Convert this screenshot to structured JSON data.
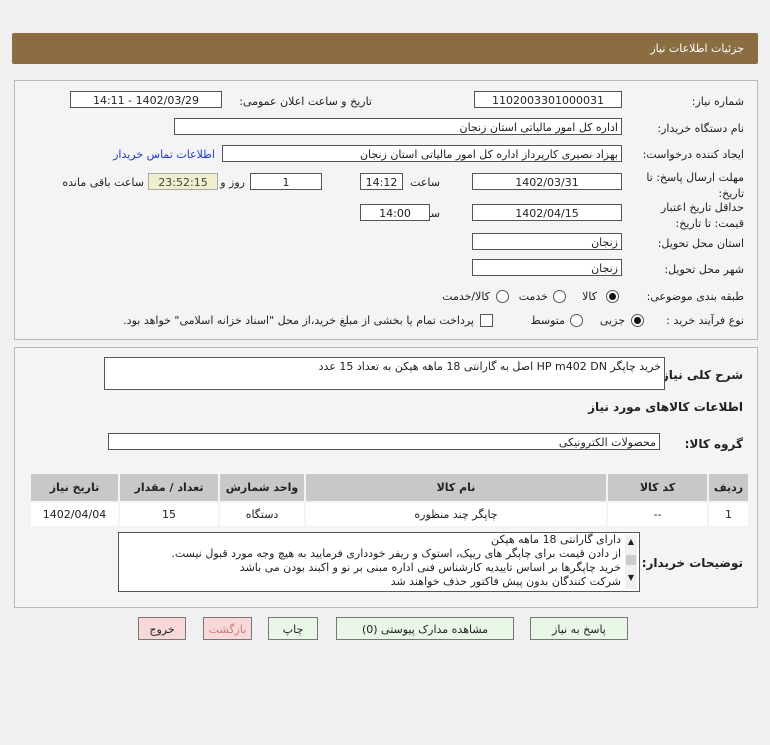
{
  "header": {
    "title": "جزئیات اطلاعات نیاز"
  },
  "form": {
    "need_number_label": "شماره نیاز:",
    "need_number": "1102003301000031",
    "announce_label": "تاریخ و ساعت اعلان عمومی:",
    "announce_value": "1402/03/29 - 14:11",
    "buyer_label": "نام دستگاه خریدار:",
    "buyer": "اداره کل امور مالیاتی استان زنجان",
    "creator_label": "ایجاد کننده درخواست:",
    "creator": "بهزاد نصیری کارپرداز اداره کل امور مالیاتی استان زنجان",
    "contact_link": "اطلاعات تماس خریدار",
    "deadline_label": "مهلت ارسال پاسخ: تا تاریخ:",
    "deadline_date": "1402/03/31",
    "time_label": "ساعت",
    "deadline_time": "14:12",
    "days": "1",
    "days_label": "روز و",
    "remaining": "23:52:15",
    "remaining_label": "ساعت باقی مانده",
    "validity_label": "حداقل تاریخ اعتبار قیمت: تا تاریخ:",
    "validity_date": "1402/04/15",
    "validity_time": "14:00",
    "province_label": "استان محل تحویل:",
    "province": "زنجان",
    "city_label": "شهر محل تحویل:",
    "city": "زنجان",
    "category_label": "طبقه بندی موضوعی:",
    "category_options": [
      "کالا",
      "خدمت",
      "کالا/خدمت"
    ],
    "category_selected": "کالا",
    "process_label": "نوع فرآیند خرید :",
    "process_options": [
      "جزیی",
      "متوسط"
    ],
    "process_selected": "جزیی",
    "payment_note": "پرداخت تمام یا بخشی از مبلغ خرید،از محل \"اسناد خزانه اسلامی\" خواهد بود."
  },
  "details": {
    "description_label": "شرح کلی نیاز:",
    "description": "خرید چاپگر HP m402 DN اصل به گارانتی 18 ماهه هپکن به تعداد 15 عدد",
    "goods_title": "اطلاعات کالاهای مورد نیاز",
    "group_label": "گروه کالا:",
    "group": "محصولات الکترونیکی",
    "table": {
      "headers": [
        "ردیف",
        "کد کالا",
        "نام کالا",
        "واحد شمارش",
        "تعداد / مقدار",
        "تاریخ نیاز"
      ],
      "rows": [
        [
          "1",
          "--",
          "چاپگر چند منظوره",
          "دستگاه",
          "15",
          "1402/04/04"
        ]
      ]
    },
    "notes_label": "توضیحات خریدار:",
    "notes": [
      "دارای گارانتی 18 ماهه هپکن",
      "از دادن قیمت برای چاپگر های ریپک، استوک و ریفر خودداری فرمایید به هیچ وجه مورد قبول نیست.",
      "خرید چاپگرها بر اساس تاییدیه کارشناس فنی اداره مبنی بر نو و اکبند بودن می باشد",
      "شرکت کنندگان بدون پیش فاکتور حذف خواهند شد"
    ]
  },
  "buttons": {
    "reply": "پاسخ به نیاز",
    "docs": "مشاهده مدارک پیوستی (0)",
    "print": "چاپ",
    "back": "بازگشت",
    "exit": "خروج"
  }
}
